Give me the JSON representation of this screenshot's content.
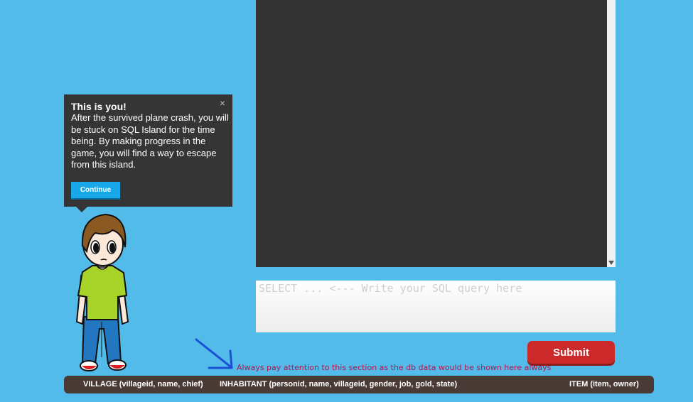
{
  "tooltip": {
    "title": "This is you!",
    "body": "After the survived plane crash, you will be stuck on SQL Island for the time being. By making progress in the game, you will find a way to escape from this island.",
    "close_glyph": "×",
    "continue_label": "Continue"
  },
  "query": {
    "placeholder": "SELECT ... <--- Write your SQL query here",
    "value": ""
  },
  "submit_label": "Submit",
  "annotation": "Always pay attention to this section as the db data would be shown here always",
  "schema": {
    "village": "VILLAGE (villageid, name, chief)",
    "inhabitant": "INHABITANT (personid, name, villageid, gender, job, gold, state)",
    "item": "ITEM (item, owner)"
  },
  "colors": {
    "background": "#52bbea",
    "terminal": "#333333",
    "submit": "#cc2a2a",
    "schema_bar": "#4a3a36",
    "annotation_text": "#b0164e",
    "annotation_arrow": "#1b4fd8"
  }
}
